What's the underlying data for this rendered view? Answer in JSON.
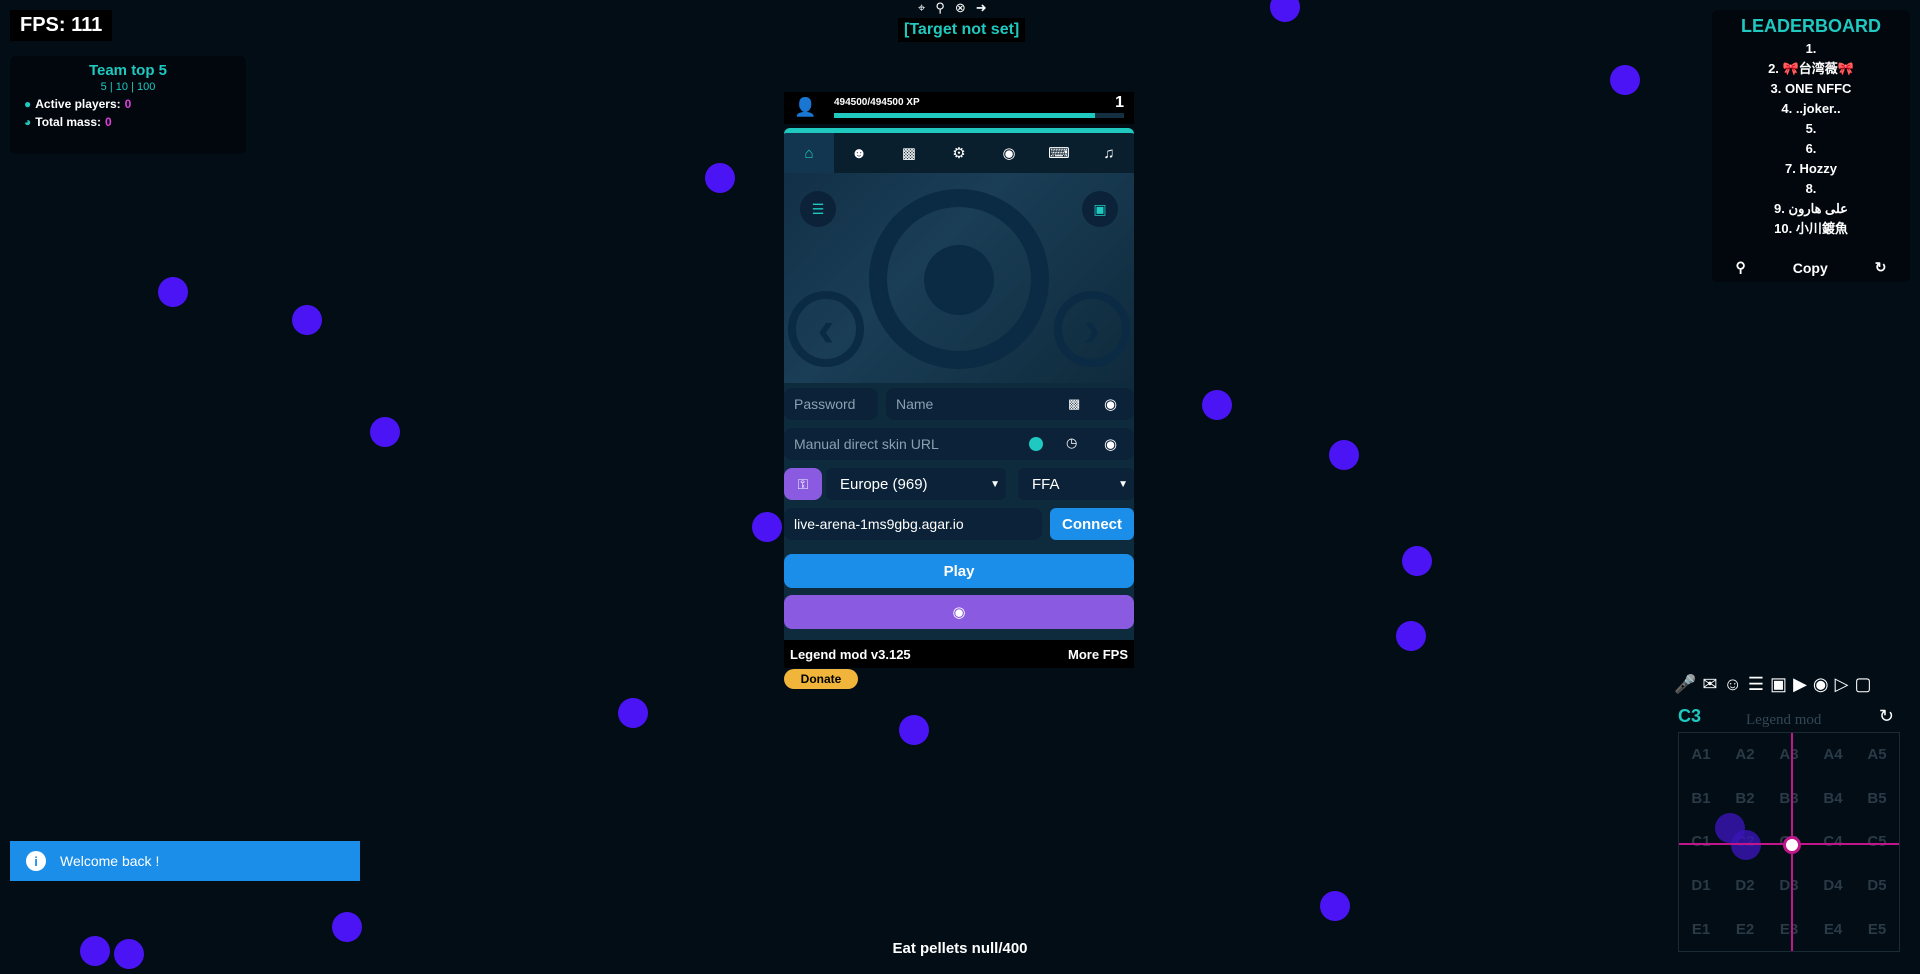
{
  "fps": "FPS: 111",
  "team": {
    "title": "Team top 5",
    "options": "5 | 10 | 100",
    "active_label": "Active players:",
    "active_value": "0",
    "mass_label": "Total mass:",
    "mass_value": "0"
  },
  "top": {
    "target": "[Target not set]",
    "icons": [
      "crosshair-icon",
      "map-pin-icon",
      "close-circle-icon",
      "arrow-right-icon"
    ]
  },
  "leaderboard": {
    "title": "LEADERBOARD",
    "entries": [
      "1.",
      "2. 🎀台湾薇🎀",
      "3. ONE NFFC",
      "4. ..joker..",
      "5.",
      "6.",
      "7. Hozzy",
      "8.",
      "9. علی هارون",
      "10. 小川鍍魚"
    ],
    "copy_label": "Copy"
  },
  "xp": {
    "text": "494500/494500 XP",
    "level": "1",
    "progress": 0.9
  },
  "tabs": [
    "home-icon",
    "user-icon",
    "puzzle-icon",
    "gear-icon",
    "droplet-icon",
    "keyboard-icon",
    "music-icon"
  ],
  "form": {
    "password_placeholder": "Password",
    "name_placeholder": "Name",
    "skin_placeholder": "Manual direct skin URL",
    "region": "Europe (969)",
    "mode": "FFA",
    "server": "live-arena-1ms9gbg.agar.io",
    "connect": "Connect",
    "play": "Play"
  },
  "footer": {
    "version": "Legend mod v3.125",
    "more_fps": "More FPS",
    "donate": "Donate"
  },
  "toast": "Welcome back !",
  "pellets": "Eat pellets null/400",
  "minimap": {
    "cell": "C3",
    "name": "Legend mod",
    "grid": [
      "A1",
      "A2",
      "A3",
      "A4",
      "A5",
      "B1",
      "B2",
      "B3",
      "B4",
      "B5",
      "C1",
      "C2",
      "C3",
      "C4",
      "C5",
      "D1",
      "D2",
      "D3",
      "D4",
      "D5",
      "E1",
      "E2",
      "E3",
      "E4",
      "E5"
    ]
  },
  "colors": {
    "accent": "#1fc9c0",
    "pellet": "#4b14f5",
    "button_blue": "#1a8ee8",
    "button_purple": "#8a5ae0",
    "magenta": "#c0158b"
  }
}
